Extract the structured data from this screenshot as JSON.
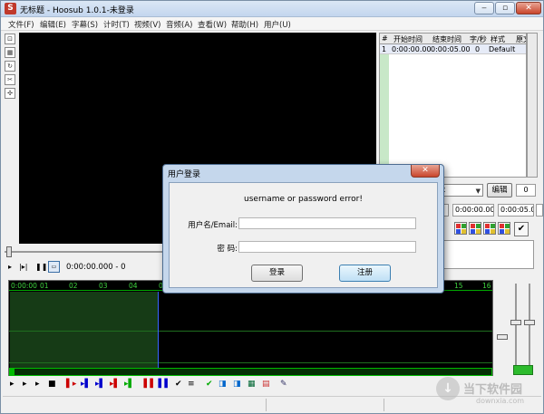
{
  "window": {
    "title": "无标题 - Hoosub 1.0.1-未登录",
    "app_icon": "S",
    "controls": {
      "minimize": "‒",
      "maximize": "▫",
      "close": "✕"
    }
  },
  "menu": {
    "items": [
      "文件(F)",
      "编辑(E)",
      "字幕(S)",
      "计时(T)",
      "视频(V)",
      "音频(A)",
      "查看(W)",
      "帮助(H)",
      "用户(U)"
    ]
  },
  "left_tools": [
    "select-tool-icon",
    "grid-tool-icon",
    "loop-tool-icon",
    "cut-tool-icon",
    "snap-tool-icon"
  ],
  "player": {
    "time": "0:00:00.000 - 0"
  },
  "subtitle_grid": {
    "columns": [
      "#",
      "开始时间",
      "结束时间",
      "字/秒",
      "样式",
      "原文"
    ],
    "rows": [
      {
        "num": "1",
        "start": "0:00:00.00",
        "end": "0:00:05.00",
        "cps": "0",
        "style": "Default",
        "text": ""
      }
    ]
  },
  "editor": {
    "style_value": "t",
    "edit_button": "编辑",
    "layer_value": "0",
    "start_time": "0:00:00.00",
    "end_time": "0:00:05.00",
    "duration": "0:00:05."
  },
  "timeline": {
    "ticks": [
      "0:00:00",
      "01",
      "02",
      "03",
      "04",
      "0",
      "15",
      "16"
    ]
  },
  "login_dialog": {
    "title": "用户登录",
    "close": "✕",
    "error_message": "username or password error!",
    "username_label": "用户名/Email:",
    "password_label": "密   码:",
    "username_value": "",
    "password_value": "",
    "login_button": "登录",
    "register_button": "注册"
  },
  "watermark": {
    "logo": "↓",
    "text": "当下软件园",
    "subtext": "downxia.com"
  },
  "colors": {
    "timeline_green": "#3fd43f",
    "playhead_blue": "#3a66ff",
    "selection": "#163b16",
    "dialog_frame": "#c5d7ec"
  }
}
